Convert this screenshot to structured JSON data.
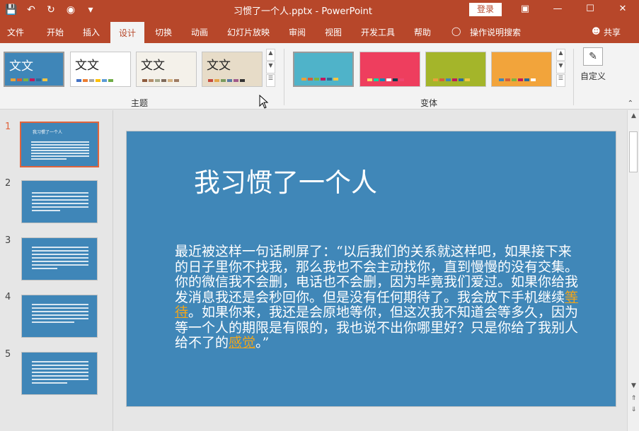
{
  "window": {
    "title": "习惯了一个人.pptx  -  PowerPoint",
    "login": "登录"
  },
  "tabs": [
    "文件",
    "开始",
    "插入",
    "设计",
    "切换",
    "动画",
    "幻灯片放映",
    "审阅",
    "视图",
    "开发工具",
    "帮助"
  ],
  "active_tab": "设计",
  "tell_me": "操作说明搜索",
  "share": "共享",
  "ribbon": {
    "themes_label": "主题",
    "variants_label": "变体",
    "theme_text": "文文",
    "custom_label": "自定义",
    "themes": [
      {
        "bg": "#3f86b8",
        "fg": "#ffffff",
        "dots": [
          "#e8a23b",
          "#d65d3a",
          "#7cb342",
          "#c2185b",
          "#2c6c9a",
          "#f4c542"
        ]
      },
      {
        "bg": "#ffffff",
        "fg": "#222222",
        "dots": [
          "#4472c4",
          "#ed7d31",
          "#a5a5a5",
          "#ffc000",
          "#5b9bd5",
          "#70ad47"
        ]
      },
      {
        "bg": "#f4f1ea",
        "fg": "#222222",
        "dots": [
          "#8e5b3d",
          "#b58d6b",
          "#a4a88b",
          "#7f6a5b",
          "#d5b282",
          "#9e7b62"
        ]
      },
      {
        "bg": "#e7dcc8",
        "fg": "#222222",
        "dots": [
          "#c64b3c",
          "#e3a74a",
          "#7a9b5e",
          "#5a7aa3",
          "#a05a8a",
          "#333333"
        ]
      }
    ],
    "variants": [
      {
        "bg": "#4fb3c9",
        "dots": [
          "#e8a23b",
          "#d65d3a",
          "#7cb342",
          "#c2185b",
          "#2c6c9a",
          "#f4c542"
        ]
      },
      {
        "bg": "#ee3e5e",
        "dots": [
          "#ffd166",
          "#06d6a0",
          "#118ab2",
          "#ffffff",
          "#073b4c",
          "#ef476f"
        ]
      },
      {
        "bg": "#a4b52a",
        "dots": [
          "#e8a23b",
          "#d65d3a",
          "#3f86b8",
          "#c2185b",
          "#2c6c9a",
          "#f4c542"
        ]
      },
      {
        "bg": "#f2a43b",
        "dots": [
          "#3f86b8",
          "#d65d3a",
          "#7cb342",
          "#c2185b",
          "#2c6c9a",
          "#ffffff"
        ]
      }
    ]
  },
  "thumbnails": [
    {
      "num": "1",
      "title": "我习惯了一个人"
    },
    {
      "num": "2",
      "title": ""
    },
    {
      "num": "3",
      "title": ""
    },
    {
      "num": "4",
      "title": ""
    },
    {
      "num": "5",
      "title": ""
    }
  ],
  "slide": {
    "title": "我习惯了一个人",
    "body_part1": "最近被这样一句话刷屏了：“以后我们的关系就这样吧，如果接下来的日子里你不找我，那么我也不会主动找你，直到慢慢的没有交集。你的微信我不会删，电话也不会删，因为毕竟我们爱过。如果你给我发消息我还是会秒回你。但是没有任何期待了。我会放下手机继续",
    "body_link1": "等待",
    "body_part2": "。如果你来，我还是会原地等你，但这次我不知道会等多久，因为等一个人的期限是有限的，我也说不出你哪里好？只是你给了我别人给不了的",
    "body_link2": "感觉",
    "body_part3": "。”"
  }
}
